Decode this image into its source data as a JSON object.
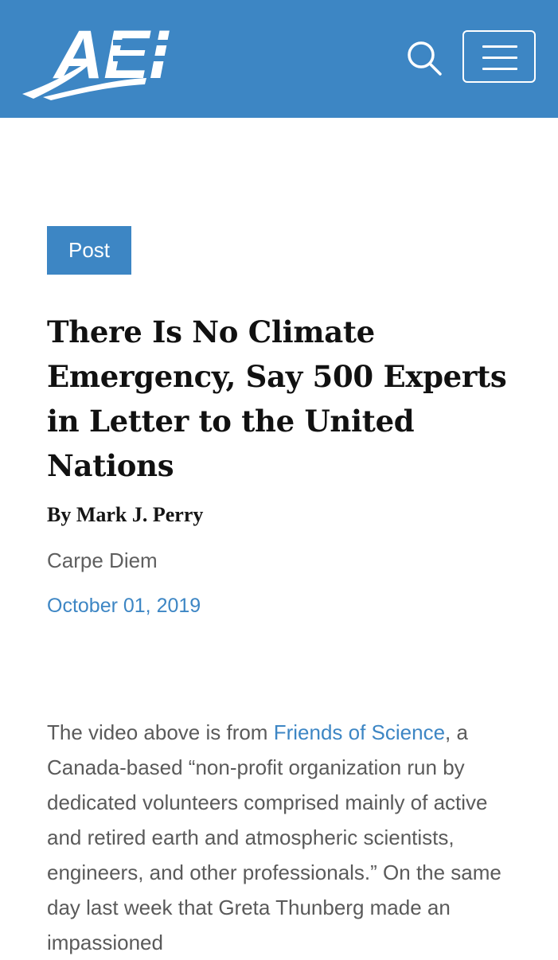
{
  "header": {
    "logo_text": "AEI",
    "search_icon": "search-icon",
    "menu_icon": "hamburger-menu-icon",
    "background_color": "#3d86c4"
  },
  "article": {
    "badge": "Post",
    "title": "There Is No Climate Emergency, Say 500 Experts in Letter to the United Nations",
    "byline": "By Mark J. Perry",
    "blog": "Carpe Diem",
    "date": "October 01, 2019",
    "body": {
      "lead": "The video above is from ",
      "link": "Friends of Science",
      "rest": ", a Canada-based “non-profit organization run by dedicated volunteers comprised mainly of active and retired earth and atmospheric scientists, engineers, and other professionals.” On the same day last week that Greta Thunberg made an impassioned"
    },
    "accent_color": "#3d86c4"
  }
}
